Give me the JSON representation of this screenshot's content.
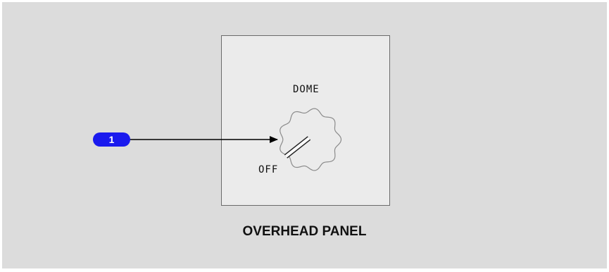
{
  "diagram": {
    "panel_title": "OVERHEAD PANEL",
    "knob": {
      "top_label": "DOME",
      "left_label": "OFF"
    },
    "callouts": [
      {
        "number": "1",
        "color": "#1a1aee"
      }
    ]
  }
}
